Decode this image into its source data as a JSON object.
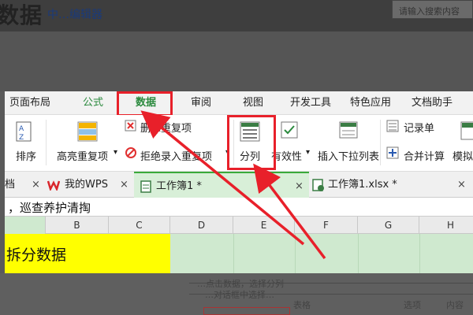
{
  "background": {
    "title": "数据",
    "subtitle": "中…编辑器",
    "search_placeholder": "请输入搜索内容",
    "caption1": "…点击数据，选择分列",
    "caption2": "…对话框中选择…",
    "cells": [
      "表格",
      "选项",
      "内容"
    ]
  },
  "ribbon_tabs": [
    {
      "label": "页面布局"
    },
    {
      "label": "公式"
    },
    {
      "label": "数据"
    },
    {
      "label": "审阅"
    },
    {
      "label": "视图"
    },
    {
      "label": "开发工具"
    },
    {
      "label": "特色应用"
    },
    {
      "label": "文档助手"
    }
  ],
  "ribbon": {
    "sort_label": "排序",
    "highlight_dup_label": "高亮重复项",
    "delete_dup_label": "删除重复项",
    "reject_dup_label": "拒绝录入重复项",
    "split_label": "分列",
    "validity_label": "有效性",
    "insert_dropdown_label": "插入下拉列表",
    "record_label": "记录单",
    "merge_calc_label": "合并计算",
    "simulate_label": "模拟"
  },
  "sheet_tabs": {
    "left_fragment": "档",
    "my_wps": "我的WPS",
    "workbook1": "工作簿1 *",
    "workbook1_xlsx": "工作簿1.xlsx *",
    "close": "×"
  },
  "formula_bar": {
    "text": "，巡查养护清掏"
  },
  "columns": [
    "",
    "B",
    "C",
    "D",
    "E",
    "F",
    "G",
    "H"
  ],
  "cell_a1": "拆分数据",
  "colors": {
    "accent_green": "#2b8a3e",
    "highlight_red": "#e8202a",
    "cell_yellow": "#ffff00",
    "selected_green": "#cfe9cf"
  }
}
